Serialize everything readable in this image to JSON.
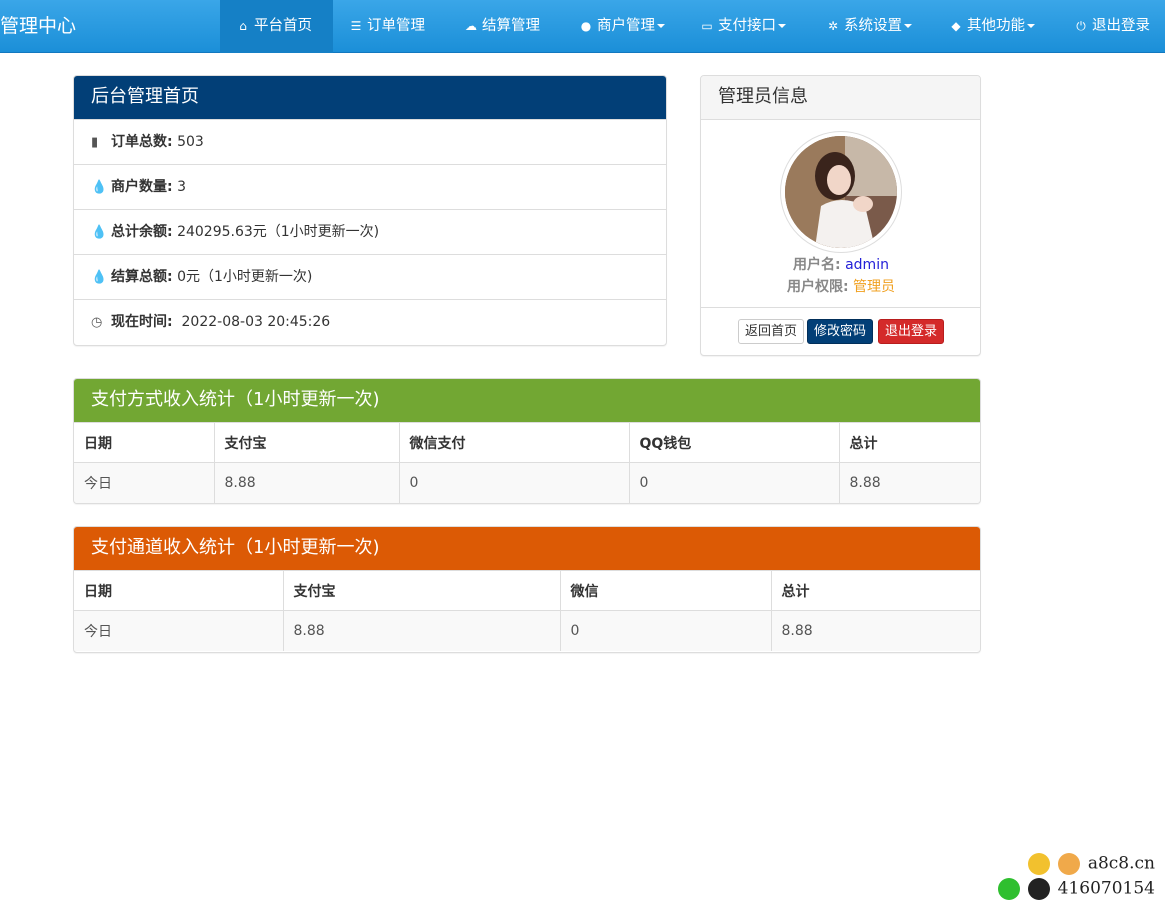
{
  "app": {
    "brand": "管理中心"
  },
  "nav": {
    "items": [
      {
        "label": "平台首页",
        "icon": "home-icon"
      },
      {
        "label": "订单管理",
        "icon": "list-icon"
      },
      {
        "label": "结算管理",
        "icon": "cloud-icon"
      },
      {
        "label": "商户管理",
        "icon": "user-icon"
      },
      {
        "label": "支付接口",
        "icon": "credit-card-icon"
      },
      {
        "label": "系统设置",
        "icon": "gear-icon"
      },
      {
        "label": "其他功能",
        "icon": "cube-icon"
      },
      {
        "label": "退出登录",
        "icon": "power-icon"
      }
    ]
  },
  "overview": {
    "title": "后台管理首页",
    "rows": [
      {
        "label": "订单总数:",
        "value": "503"
      },
      {
        "label": "商户数量:",
        "value": "3"
      },
      {
        "label": "总计余额:",
        "value": "240295.63元（1小时更新一次)"
      },
      {
        "label": "结算总额:",
        "value": "0元（1小时更新一次)"
      },
      {
        "label": "现在时间:",
        "value": "2022-08-03 20:45:26"
      }
    ]
  },
  "admin": {
    "title": "管理员信息",
    "username_label": "用户名:",
    "username": "admin",
    "role_label": "用户权限:",
    "role": "管理员",
    "buttons": {
      "home": "返回首页",
      "change_password": "修改密码",
      "logout": "退出登录"
    }
  },
  "pay_method_stats": {
    "title": "支付方式收入统计（1小时更新一次)",
    "headers": [
      "日期",
      "支付宝",
      "微信支付",
      "QQ钱包",
      "总计"
    ],
    "row": [
      "今日",
      "8.88",
      "0",
      "0",
      "8.88"
    ]
  },
  "pay_channel_stats": {
    "title": "支付通道收入统计（1小时更新一次)",
    "headers": [
      "日期",
      "支付宝",
      "微信",
      "总计"
    ],
    "row": [
      "今日",
      "8.88",
      "0",
      "8.88"
    ]
  },
  "watermark": {
    "site": "a8c8.cn",
    "qq": "416070154"
  },
  "colors": {
    "nav": "#1b8fd8",
    "overview_head": "#023f77",
    "method_head": "#72a733",
    "channel_head": "#dc5a05",
    "username": "#2420d8",
    "role": "#f0a020"
  }
}
